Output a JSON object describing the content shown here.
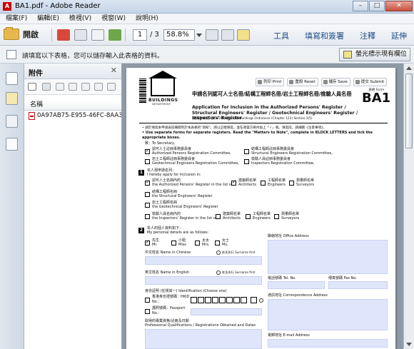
{
  "window": {
    "title": "BA1.pdf - Adobe Reader",
    "minimize": "–",
    "maximize": "□",
    "close": "✕"
  },
  "menu": [
    "檔案(F)",
    "編輯(E)",
    "檢視(V)",
    "視窗(W)",
    "說明(H)"
  ],
  "toolbar": {
    "open_label": "開啟",
    "page_current": "1",
    "page_total": "/ 3",
    "zoom": "58.8%",
    "tools": "工具",
    "fill_sign": "填寫和簽署",
    "comment": "注釋",
    "extend": "延伸"
  },
  "notice": {
    "message": "請填寫以下表格，您可以儲存輸入此表格的資料。",
    "highlight_button": "螢光標示現有欄位"
  },
  "attachments": {
    "title": "附件",
    "close": "✕",
    "column_name": "名稱",
    "files": [
      "0A97AB75-E955-46FC-8AA3-32"
    ]
  },
  "document": {
    "buttons": {
      "print": "列印 Print",
      "reset": "重設 Reset",
      "save": "儲存 Save",
      "submit": "提交 Submit"
    },
    "form_label": "表格 Form",
    "form_code": "BA1",
    "logo_text": "BUILDINGS",
    "logo_dept": "DEPARTMENT",
    "title_zh": "申請名列認可人士名冊/結構工程師名冊/岩土工程師名冊/檢驗人員名冊",
    "title_en": "Application for Inclusion in the Authorized Persons' Register / Structural Engineers' Register / Geotechnical Engineers' Register / Inspectors' Register",
    "ordinance": "(建築物條例) (第123章) 第3(5)條   Buildings Ordinance (Chapter 123) Section 3(5)",
    "notes": [
      "• 請於填寫本申請表前細閱列於本表格的\"須知\"，請以正楷填寫，並在適當方格內加上「✓」號。填寫前，請細閱《注意事項》。",
      "• Please read the \"Matters to Note\", complete in BLOCK LETTERS and tick the appropriate boxes.",
      "• Use separate forms for separate registers. Read the \"Matters to Note\", complete in BLOCK LETTERS and tick the appropriate boxes."
    ],
    "to_secretary": "致：To Secretary,",
    "committees": [
      {
        "zh": "認可人士註冊事務委員會",
        "en": "Authorized Persons Registration Committee,",
        "checked": true
      },
      {
        "zh": "結構工程師註冊事務委員會",
        "en": "Structural Engineers Registration Committee,",
        "checked": false
      },
      {
        "zh": "岩土工程師註冊事務委員會",
        "en": "Geotechnical Engineers Registration Committee,",
        "checked": false
      },
      {
        "zh": "檢驗人員註冊事務委員會",
        "en": "Inspectors Registration Committee,",
        "checked": false
      }
    ],
    "section1": {
      "num": "1",
      "heading_zh": "本人現申請名列：",
      "heading_en": "I hereby apply for inclusion in:",
      "ap_zh": "認可人士名冊內的",
      "ap_en": "the Authorized Persons' Register in the list of",
      "ap_options": [
        {
          "zh": "建築師名單",
          "en": "Architects",
          "checked": true
        },
        {
          "zh": "工程師名單",
          "en": "Engineers",
          "checked": false
        },
        {
          "zh": "測量師名單",
          "en": "Surveyors",
          "checked": false
        }
      ],
      "se_zh": "結構工程師名冊",
      "se_en": "the Structural Engineers' Register",
      "ge_zh": "岩土工程師名冊",
      "ge_en": "the Geotechnical Engineers' Register",
      "ir_zh": "檢驗人員名冊內的",
      "ir_en": "the Inspectors' Register in the list of",
      "ir_options": [
        {
          "zh": "建築師名單",
          "en": "Architects"
        },
        {
          "zh": "工程師名單",
          "en": "Engineers"
        },
        {
          "zh": "測量師名單",
          "en": "Surveyors"
        }
      ]
    },
    "section2": {
      "num": "2",
      "heading_zh": "本人的個人資料如下：",
      "heading_en": "My personal details are as follows:",
      "titles": [
        {
          "zh": "先生",
          "en": "Mr.",
          "checked": true
        },
        {
          "zh": "小姐",
          "en": "Miss",
          "checked": false
        },
        {
          "zh": "太太",
          "en": "Mrs.",
          "checked": false
        },
        {
          "zh": "女士",
          "en": "Ms.",
          "checked": false
        }
      ],
      "office_address": "聯絡地址 Office Address",
      "name_zh": "中文姓名 Name in Chinese",
      "name_en": "英文姓名 Name in English",
      "surname_first": "姓氏先行 Surname first",
      "tel": "電話號碼 Tel. No.",
      "fax": "傳真號碼 Fax No.",
      "id_label": "身份証明 (任擇其一) Identification (Choose one)",
      "hkid": "香港身份證號碼：HKID No.：",
      "passport": "護照號碼：Passport No.：",
      "corr_address": "通訊地址 Correspondence Address",
      "qualifications": "取得的專業資格/註冊及日期",
      "qualifications_en": "Professional Qualifications / Registrations Obtained and Dates",
      "email": "電郵地址 E-mail Address"
    }
  }
}
